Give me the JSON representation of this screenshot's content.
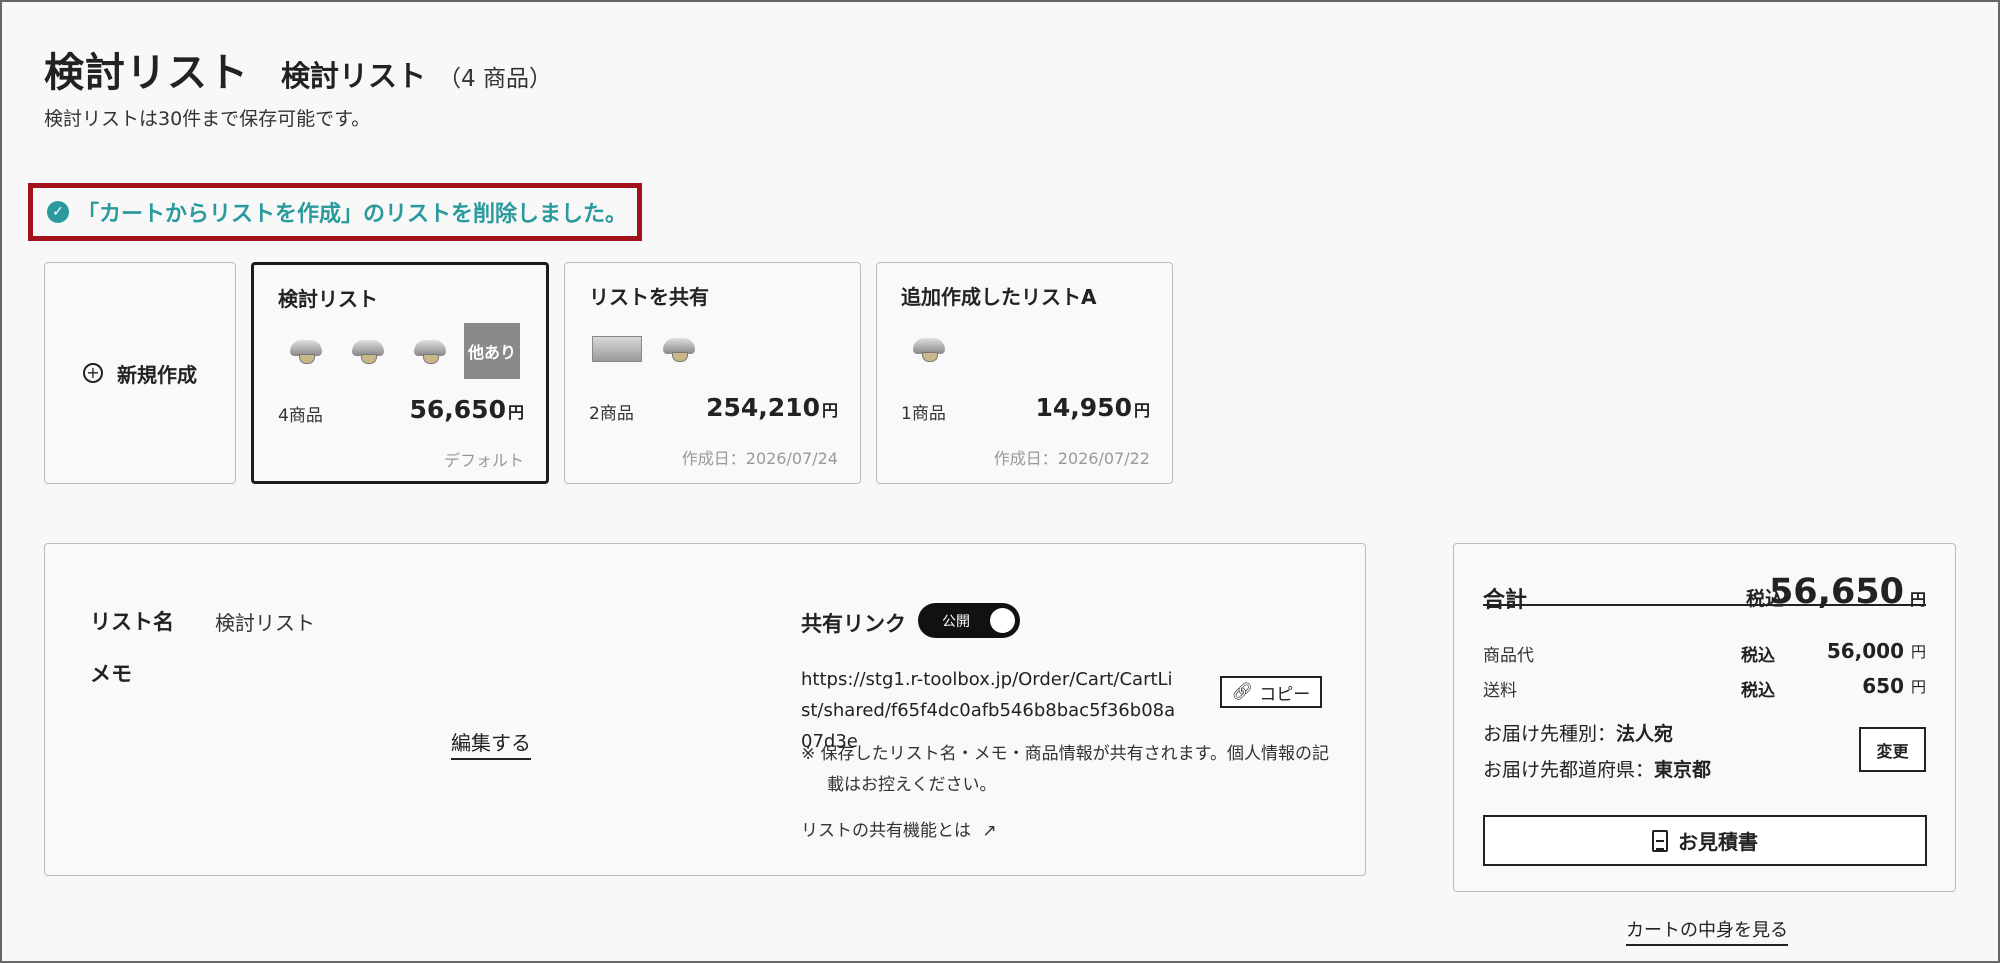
{
  "header": {
    "title": "検討リスト",
    "list_title": "検討リスト",
    "count": "（4 商品）",
    "description": "検討リストは30件まで保存可能です。"
  },
  "notice": {
    "message": "「カートからリストを作成」のリストを削除しました。"
  },
  "new_card": {
    "label": "新規作成"
  },
  "lists": [
    {
      "name": "検討リスト",
      "items": "4商品",
      "price": "56,650",
      "yen": "円",
      "footer": "デフォルト",
      "more": "他あり"
    },
    {
      "name": "リストを共有",
      "items": "2商品",
      "price": "254,210",
      "yen": "円",
      "footer": "作成日：2026/07/24"
    },
    {
      "name": "追加作成したリストA",
      "items": "1商品",
      "price": "14,950",
      "yen": "円",
      "footer": "作成日：2026/07/22"
    }
  ],
  "detail": {
    "list_name_label": "リスト名",
    "list_name_value": "検討リスト",
    "memo_label": "メモ",
    "edit_label": "編集する",
    "share_label": "共有リンク",
    "toggle_label": "公開",
    "share_url": "https://stg1.r-toolbox.jp/Order/Cart/CartList/shared/f65f4dc0afb546b8bac5f36b08a07d3e",
    "copy_label": "コピー",
    "note": "※  保存したリスト名・メモ・商品情報が共有されます。個人情報の記載はお控えください。",
    "help_link": "リストの共有機能とは"
  },
  "summary": {
    "title": "合計",
    "tax_label": "税込",
    "total": "56,650",
    "yen": "円",
    "rows": [
      {
        "label": "商品代",
        "tax": "税込",
        "value": "56,000",
        "yen": "円"
      },
      {
        "label": "送料",
        "tax": "税込",
        "value": "650",
        "yen": "円"
      }
    ],
    "dest_type_label": "お届け先種別：",
    "dest_type_value": "法人宛",
    "dest_pref_label": "お届け先都道府県：",
    "dest_pref_value": "東京都",
    "change_label": "変更",
    "quote_label": "お見積書"
  },
  "cart_link": "カートの中身を見る",
  "colors": {
    "accent": "#2b9a9d",
    "notice_border": "#a31218"
  }
}
